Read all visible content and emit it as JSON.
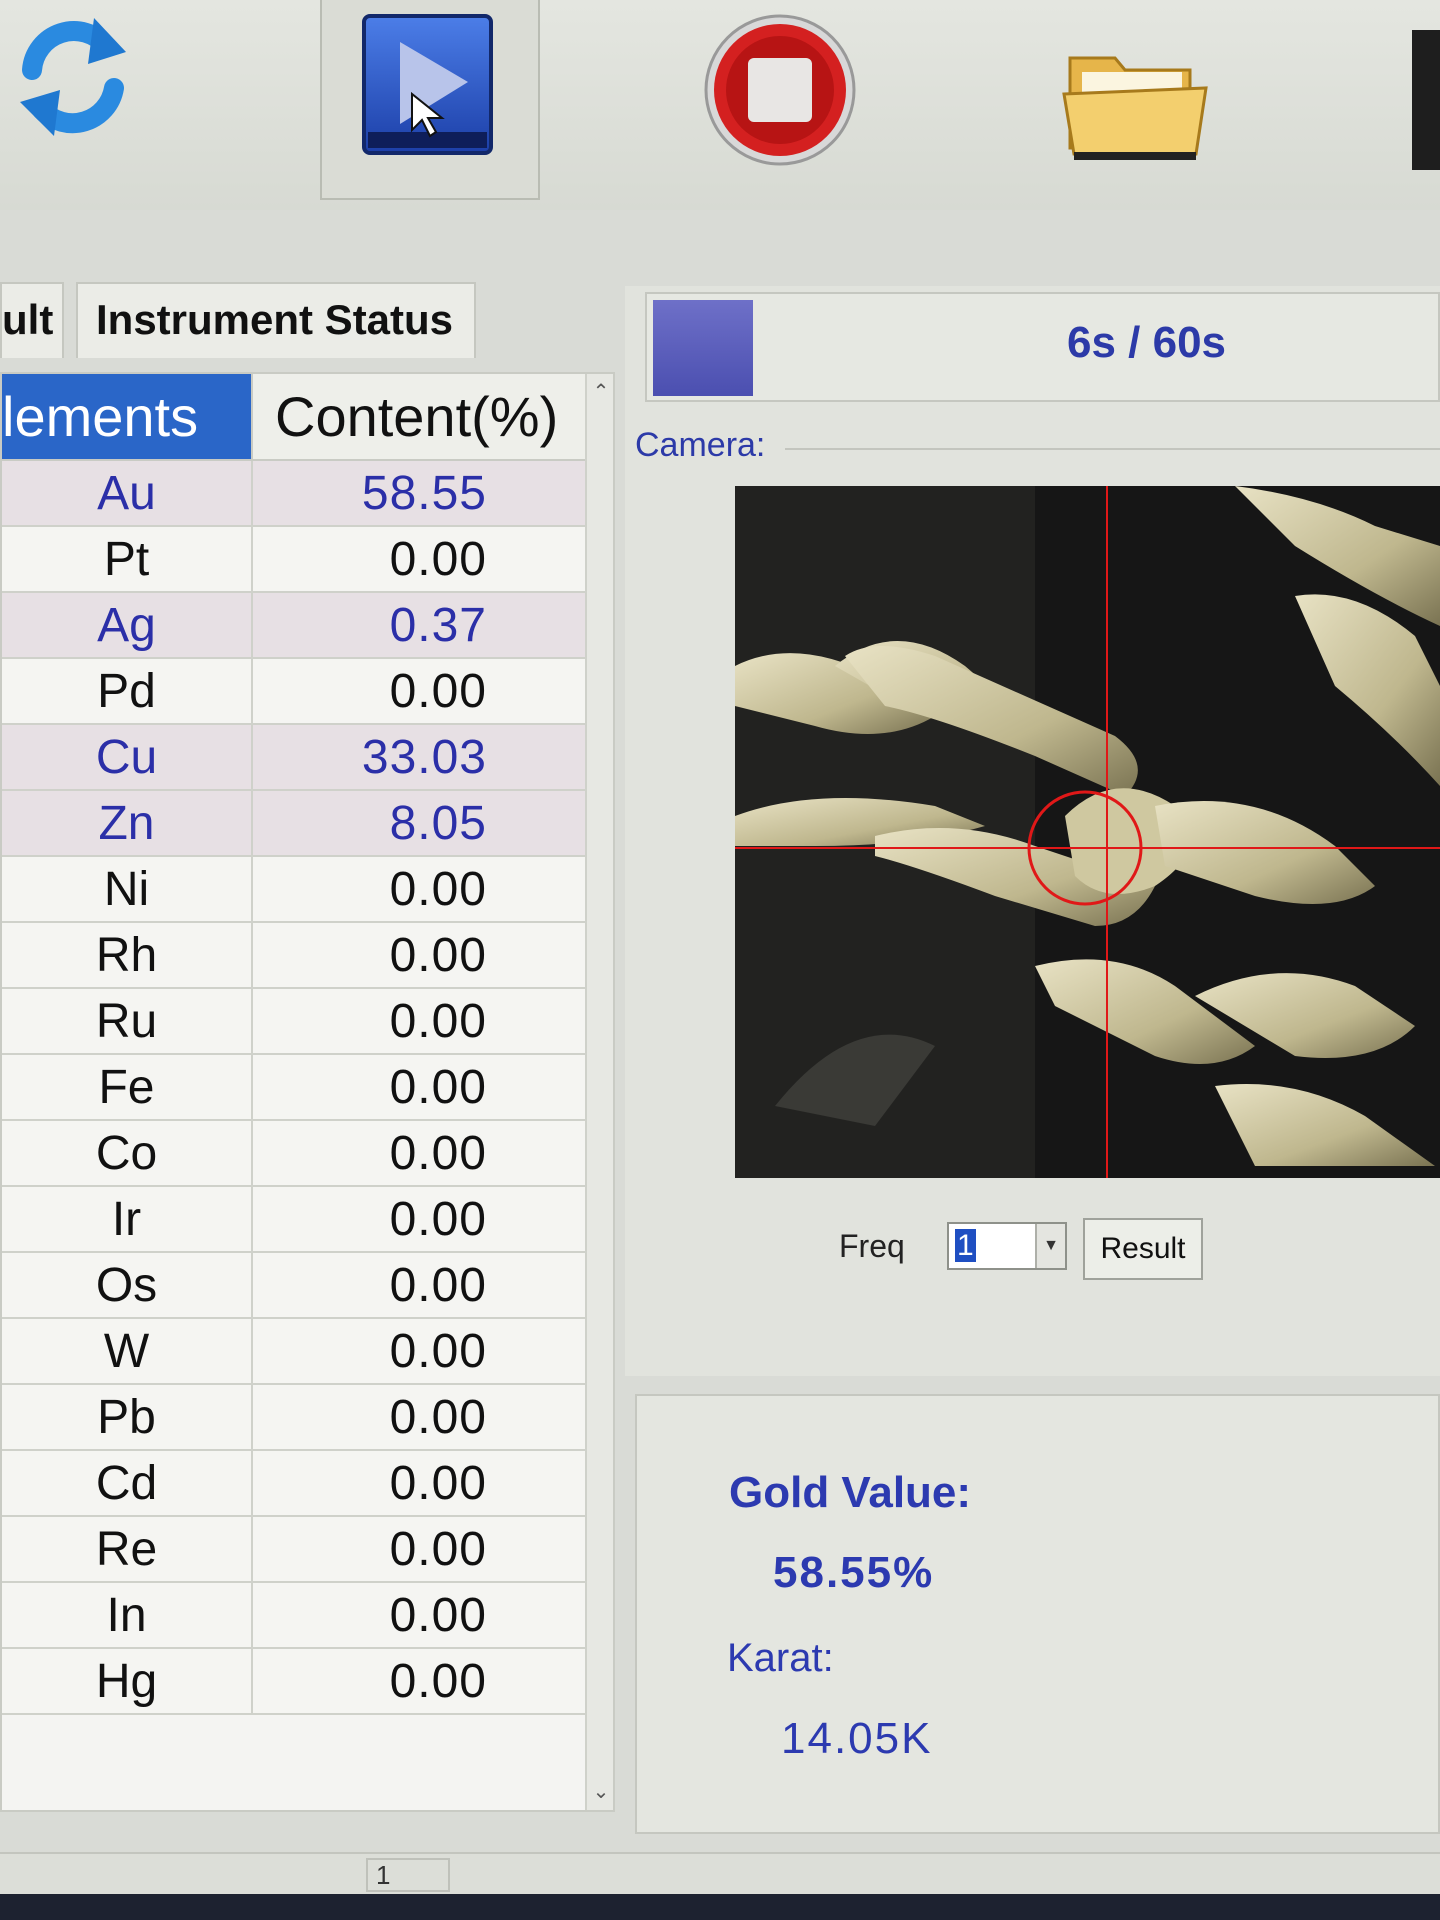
{
  "toolbar": {
    "buttons": [
      {
        "name": "refresh",
        "icon": "refresh-icon"
      },
      {
        "name": "start",
        "icon": "play-icon"
      },
      {
        "name": "stop",
        "icon": "stop-icon"
      },
      {
        "name": "open",
        "icon": "folder-icon"
      }
    ]
  },
  "tabs": [
    {
      "label": "ult"
    },
    {
      "label": "Instrument Status"
    }
  ],
  "table": {
    "headers": [
      "lements",
      "Content(%)"
    ],
    "rows": [
      {
        "element": "Au",
        "content": "58.55",
        "highlight": true
      },
      {
        "element": "Pt",
        "content": "0.00",
        "highlight": false
      },
      {
        "element": "Ag",
        "content": "0.37",
        "highlight": true
      },
      {
        "element": "Pd",
        "content": "0.00",
        "highlight": false
      },
      {
        "element": "Cu",
        "content": "33.03",
        "highlight": true
      },
      {
        "element": "Zn",
        "content": "8.05",
        "highlight": true
      },
      {
        "element": "Ni",
        "content": "0.00",
        "highlight": false
      },
      {
        "element": "Rh",
        "content": "0.00",
        "highlight": false
      },
      {
        "element": "Ru",
        "content": "0.00",
        "highlight": false
      },
      {
        "element": "Fe",
        "content": "0.00",
        "highlight": false
      },
      {
        "element": "Co",
        "content": "0.00",
        "highlight": false
      },
      {
        "element": "Ir",
        "content": "0.00",
        "highlight": false
      },
      {
        "element": "Os",
        "content": "0.00",
        "highlight": false
      },
      {
        "element": "W",
        "content": "0.00",
        "highlight": false
      },
      {
        "element": "Pb",
        "content": "0.00",
        "highlight": false
      },
      {
        "element": "Cd",
        "content": "0.00",
        "highlight": false
      },
      {
        "element": "Re",
        "content": "0.00",
        "highlight": false
      },
      {
        "element": "In",
        "content": "0.00",
        "highlight": false
      },
      {
        "element": "Hg",
        "content": "0.00",
        "highlight": false
      }
    ]
  },
  "progress": {
    "timer": "6s / 60s",
    "fraction": 0.1
  },
  "camera": {
    "label": "Camera:"
  },
  "controls": {
    "freq_label": "Freq",
    "freq_value": "1",
    "result_label": "Result"
  },
  "gold": {
    "value_label": "Gold Value:",
    "value": "58.55%",
    "karat_label": "Karat:",
    "karat": "14.05K"
  },
  "status_bar": {
    "page": "1"
  },
  "colors": {
    "accent_blue": "#2c3aa8",
    "header_blue": "#2a66c8",
    "stop_red": "#d42020",
    "crosshair_red": "#e01818"
  }
}
